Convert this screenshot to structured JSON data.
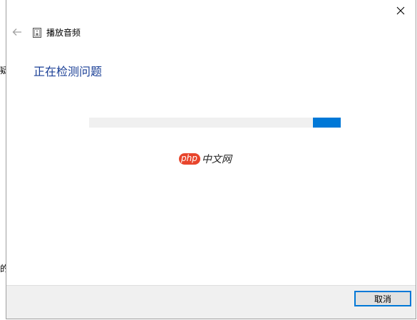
{
  "window": {
    "title": "播放音频",
    "title_icon": "speaker-device-icon",
    "close_glyph": "✕",
    "back_glyph": "←"
  },
  "backdrop": {
    "text_fragment_1": "疑",
    "text_fragment_2": "的"
  },
  "main": {
    "heading": "正在检测问题",
    "progress": {
      "mode": "indeterminate",
      "chunk_start_fraction": 0.89,
      "chunk_end_fraction": 1.0
    }
  },
  "watermark": {
    "brand": "php",
    "suffix": "中文网"
  },
  "footer": {
    "cancel_label": "取消"
  },
  "colors": {
    "accent": "#0078d7",
    "heading": "#1a3f96",
    "track": "#f0f0f0",
    "footer_bg": "#f0f0f0",
    "watermark_red": "#e8452c"
  }
}
